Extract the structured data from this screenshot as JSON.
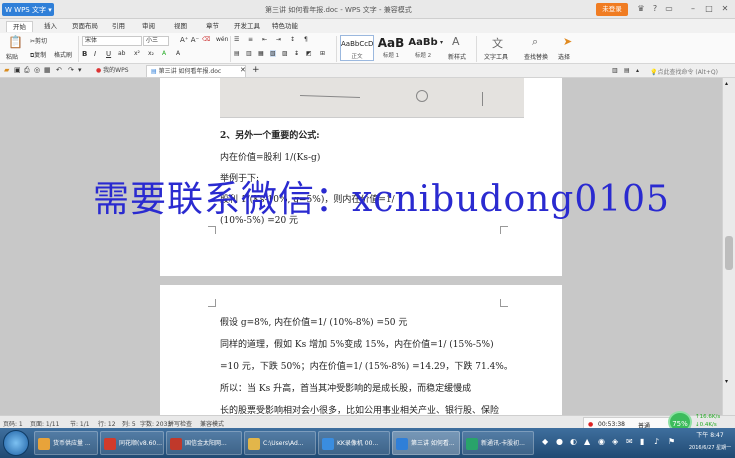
{
  "app": {
    "menu_label": "WPS 文字",
    "window_title": "第三讲 如何看年报.doc - WPS 文字 - 兼容模式",
    "login_label": "未登录"
  },
  "menu_tabs": [
    "开始",
    "插入",
    "页面布局",
    "引用",
    "审阅",
    "视图",
    "章节",
    "开发工具",
    "特色功能"
  ],
  "ribbon": {
    "paste": "粘贴",
    "cut": "剪切",
    "copy": "复制",
    "format_painter": "格式刷",
    "font_name": "宋体",
    "font_size": "小三",
    "styles": [
      {
        "preview": "AaBbCcD",
        "label": "正文"
      },
      {
        "preview": "AaB",
        "label": "标题 1"
      },
      {
        "preview": "AaBb",
        "label": "标题 2"
      }
    ],
    "new_style": "新样式",
    "text_tools": "文字工具",
    "find_replace": "查找替换",
    "select": "选择"
  },
  "doc_tabs": {
    "home": "我的WPS",
    "current": "第三讲 如何看年报.doc",
    "command_search": "点此查找命令 (Alt+Q)"
  },
  "page1": {
    "heading": "2、另外一个重要的公式:",
    "formula": "内在价值=股利 1/(Ks-g)",
    "line3": "举例于下:",
    "line4": "股利 1/(Ks-10%, g=5%)，则内在价值=1/",
    "line5": "(10%-5%) =20 元"
  },
  "page2": {
    "line1": "假设 g=8%, 内在价值=1/ (10%-8%) =50 元",
    "line2": "同样的道理，假如 Ks 增加 5%变成 15%，内在价值=1/ (15%-5%)",
    "line3": "=10 元，下跌 50%；内在价值=1/ (15%-8%) =14.29，下跌 71.4%。",
    "line4": "所以：当 Ks 升高，首当其冲受影响的是成长股，而稳定缓慢成",
    "line5": "长的股票受影响相对会小很多，比如公用事业相关产业、银行股、保险"
  },
  "watermark": "需要联系微信：xcnibudong0105",
  "status": {
    "page": "页码: 1",
    "pages": "页面: 1/11",
    "section": "节: 1/1",
    "row": "行: 12",
    "col": "列: 5",
    "wordcount": "字数: 2033",
    "spell": "拼写检查",
    "compat": "兼容模式"
  },
  "recorder": {
    "time": "00:53:38",
    "normal": "普通"
  },
  "network": {
    "percent": "75%",
    "up": "16.6K/s",
    "down": "0.4K/s"
  },
  "taskbar": {
    "tasks": [
      {
        "label": "货币供应量 ...",
        "color": "#e8a33a"
      },
      {
        "label": "同花顺(v8.60...",
        "color": "#d23b2b"
      },
      {
        "label": "国信金太阳网...",
        "color": "#c0392b"
      },
      {
        "label": "C:\\Users\\Ad...",
        "color": "#e2b64a"
      },
      {
        "label": "KK录像机 00...",
        "color": "#3a8de0"
      },
      {
        "label": "第三讲 如何看...",
        "color": "#2f7fd8"
      },
      {
        "label": "新通讯-卡股初...",
        "color": "#29a36a"
      }
    ],
    "time": "下午 8:47",
    "date": "2016/6/27 星期一"
  }
}
